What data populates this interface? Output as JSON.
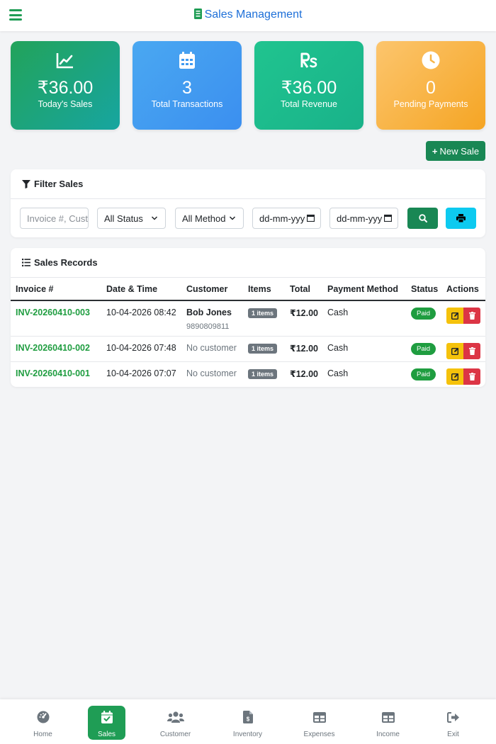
{
  "header": {
    "title": "Sales Management",
    "icon": "receipt-icon"
  },
  "stats": [
    {
      "value": "₹36.00",
      "label": "Today's Sales",
      "icon": "chart-line-icon"
    },
    {
      "value": "3",
      "label": "Total Transactions",
      "icon": "calendar-icon"
    },
    {
      "value": "₹36.00",
      "label": "Total Revenue",
      "icon": "rupee-icon"
    },
    {
      "value": "0",
      "label": "Pending Payments",
      "icon": "clock-icon"
    }
  ],
  "new_sale_label": "New Sale",
  "filter": {
    "title": "Filter Sales",
    "search_placeholder": "Invoice #, Cust",
    "status_value": "All Status",
    "method_value": "All Method",
    "date_from_placeholder": "dd-mm-yyy",
    "date_to_placeholder": "dd-mm-yyy"
  },
  "records": {
    "title": "Sales Records",
    "columns": [
      "Invoice #",
      "Date & Time",
      "Customer",
      "Items",
      "Total",
      "Payment Method",
      "Status",
      "Actions"
    ],
    "rows": [
      {
        "invoice": "INV-20260410-003",
        "datetime": "10-04-2026 08:42",
        "customer": "Bob Jones",
        "phone": "9890809811",
        "items": "1 items",
        "total": "₹12.00",
        "method": "Cash",
        "status": "Paid"
      },
      {
        "invoice": "INV-20260410-002",
        "datetime": "10-04-2026 07:48",
        "customer": "No customer",
        "phone": "",
        "items": "1 items",
        "total": "₹12.00",
        "method": "Cash",
        "status": "Paid"
      },
      {
        "invoice": "INV-20260410-001",
        "datetime": "10-04-2026 07:07",
        "customer": "No customer",
        "phone": "",
        "items": "1 items",
        "total": "₹12.00",
        "method": "Cash",
        "status": "Paid"
      }
    ]
  },
  "bottom_nav": [
    {
      "label": "Home",
      "icon": "dashboard-icon"
    },
    {
      "label": "Sales",
      "icon": "calendar-check-icon",
      "active": true
    },
    {
      "label": "Customer",
      "icon": "users-icon"
    },
    {
      "label": "Inventory",
      "icon": "file-invoice-dollar-icon"
    },
    {
      "label": "Expenses",
      "icon": "table-icon"
    },
    {
      "label": "Income",
      "icon": "table-icon"
    },
    {
      "label": "Exit",
      "icon": "sign-out-icon"
    }
  ],
  "colors": {
    "brand_green": "#1f9d55",
    "title_blue": "#1d6fd8",
    "paid_green": "#1f9d40",
    "edit_yellow": "#f5c20b",
    "delete_red": "#dc3545",
    "print_cyan": "#0dcaf0"
  }
}
